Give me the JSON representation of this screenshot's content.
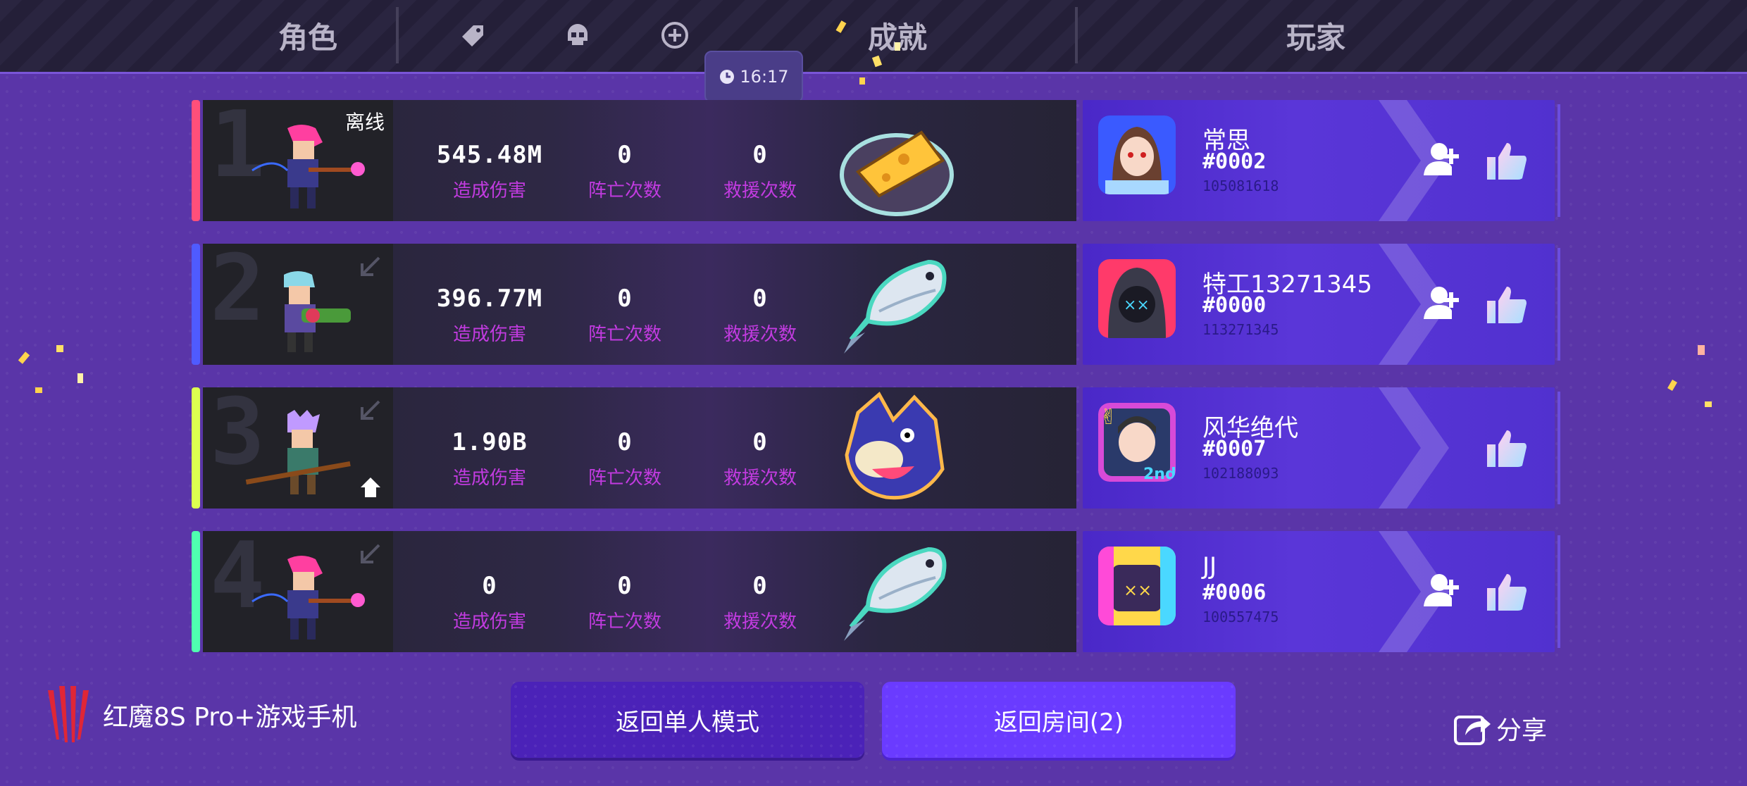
{
  "header": {
    "tabs": {
      "role": "角色",
      "achievement": "成就",
      "player": "玩家"
    },
    "icons": [
      "tag-icon",
      "skull-icon",
      "plus-circle-icon"
    ],
    "clock": "16:17"
  },
  "rows": [
    {
      "rank": "1",
      "status": "离线",
      "stripe": "#ff4f7a",
      "damage": "545.48M",
      "deaths": "0",
      "rescues": "0",
      "labels": {
        "damage": "造成伤害",
        "deaths": "阵亡次数",
        "rescues": "救援次数"
      },
      "achievement": "cheese",
      "player": {
        "name": "常思",
        "num": "#0002",
        "id": "105081618"
      },
      "show_add": true
    },
    {
      "rank": "2",
      "status": "",
      "stripe": "#4f5bff",
      "damage": "396.77M",
      "deaths": "0",
      "rescues": "0",
      "labels": {
        "damage": "造成伤害",
        "deaths": "阵亡次数",
        "rescues": "救援次数"
      },
      "achievement": "fish",
      "player": {
        "name": "特工13271345",
        "num": "#0000",
        "id": "113271345"
      },
      "show_add": true
    },
    {
      "rank": "3",
      "status": "",
      "stripe": "#dcff4f",
      "damage": "1.90B",
      "deaths": "0",
      "rescues": "0",
      "labels": {
        "damage": "造成伤害",
        "deaths": "阵亡次数",
        "rescues": "救援次数"
      },
      "achievement": "wolf",
      "player": {
        "name": "风华绝代",
        "num": "#0007",
        "id": "102188093"
      },
      "show_add": false
    },
    {
      "rank": "4",
      "status": "",
      "stripe": "#4fffb0",
      "damage": "0",
      "deaths": "0",
      "rescues": "0",
      "labels": {
        "damage": "造成伤害",
        "deaths": "阵亡次数",
        "rescues": "救援次数"
      },
      "achievement": "fish",
      "player": {
        "name": "JJ",
        "num": "#0006",
        "id": "100557475"
      },
      "show_add": true
    }
  ],
  "footer": {
    "brand": "红魔8S Pro+游戏手机",
    "back_single": "返回单人模式",
    "back_room": "返回房间(2)",
    "share": "分享"
  }
}
